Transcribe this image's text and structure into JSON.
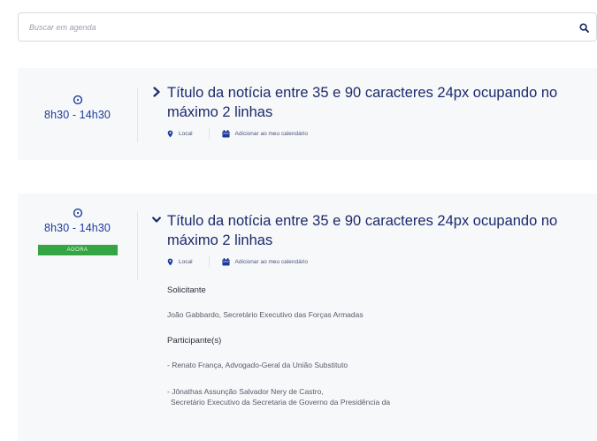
{
  "search": {
    "placeholder": "Buscar em agenda",
    "icon": "search-icon"
  },
  "colors": {
    "accent": "#1b3b9a",
    "title": "#1b2a6b",
    "badge": "#33a542",
    "card_background": "#f7f8fa"
  },
  "events": [
    {
      "time": "8h30 - 14h30",
      "title": "Título da notícia entre 35 e 90 caracteres 24px ocupando no máximo 2 linhas",
      "expanded": false,
      "location_label": "Local",
      "calendar_label": "Adicionar ao meu calendário"
    },
    {
      "time": "8h30 - 14h30",
      "badge": "AGORA",
      "title": "Título da notícia entre 35 e 90 caracteres 24px ocupando no máximo 2 linhas",
      "expanded": true,
      "location_label": "Local",
      "calendar_label": "Adicionar ao meu calendário",
      "details": {
        "requester_label": "Solicitante",
        "requester": "João Gabbardo, Secretário Executivo das Forças Armadas",
        "participants_label": "Participante(s)",
        "participants": [
          "- Renato França, Advogado-Geral da União Substituto",
          "- Jônathas Assunção Salvador Nery de Castro,",
          "Secretário Executivo da Secretaria de Governo da Presidência da"
        ]
      }
    }
  ]
}
